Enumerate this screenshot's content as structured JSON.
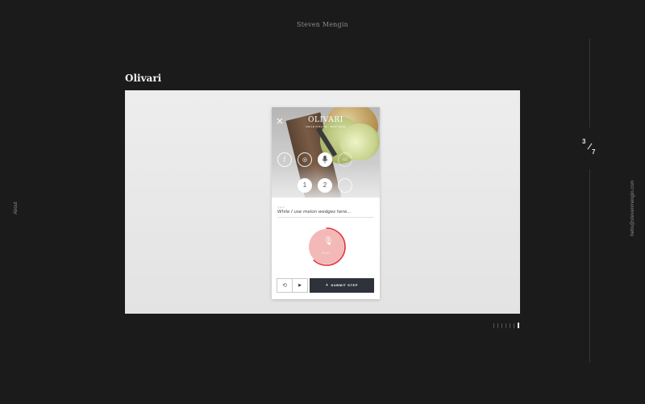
{
  "site": {
    "title": "Steven Mengin",
    "about_label": "About",
    "email": "hello@stevenmengin.com"
  },
  "counter": {
    "current": "3",
    "total": "7"
  },
  "project": {
    "title": "Olivari"
  },
  "app": {
    "close_icon": "×",
    "brand_name": "OLIVARI",
    "brand_tagline": "HUILE D'OLIVE · BOUTIQUE",
    "toolbar_icons": [
      "info-icon",
      "kitchen-icon",
      "microphone-icon",
      "video-icon"
    ],
    "toolbar_glyphs": {
      "info": "i",
      "kitchen": "◎",
      "mic": "🎙",
      "video": "▭"
    },
    "steps": [
      "1",
      "2",
      ""
    ],
    "step_label": "STEP",
    "step_text": "While I use melon wedges here...",
    "record": {
      "mic_glyph": "🎙",
      "time": "0:17",
      "progress": 0.62,
      "accent": "#e0323a",
      "fill": "#f2b9b7"
    },
    "controls": {
      "undo_glyph": "⟲",
      "play_glyph": "▶",
      "submit_plus": "+",
      "submit_label": "SUBMIT STEP"
    }
  },
  "pager": {
    "count": 7,
    "active_index": 6
  }
}
